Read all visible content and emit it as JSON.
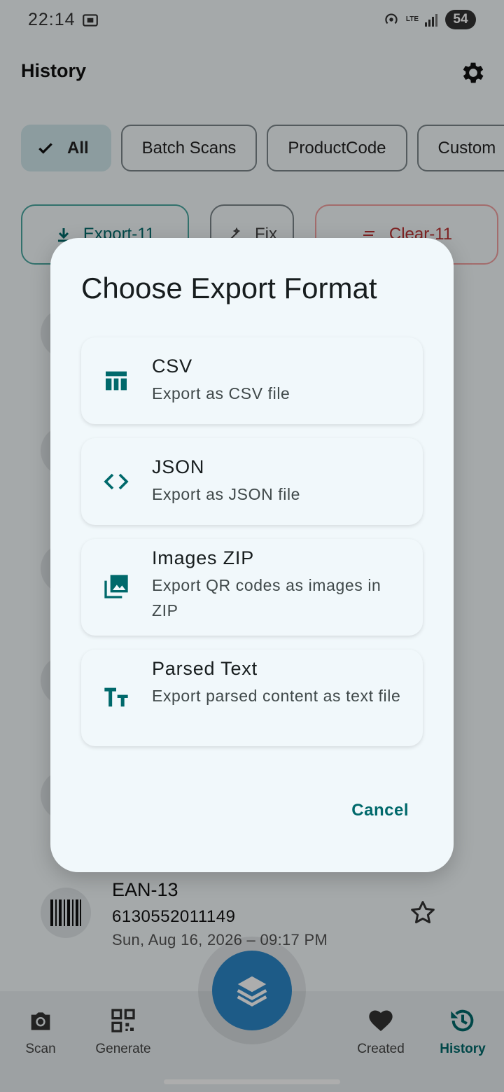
{
  "status_bar": {
    "time": "22:14",
    "network": "LTE",
    "battery": "54"
  },
  "topbar": {
    "title": "History"
  },
  "filters": [
    "All",
    "Batch Scans",
    "ProductCode",
    "Custom"
  ],
  "actions": {
    "export": "Export-11",
    "fix": "Fix",
    "clear": "Clear-11"
  },
  "dialog": {
    "title": "Choose Export Format",
    "options": [
      {
        "title": "CSV",
        "description": "Export as CSV file",
        "icon": "table-icon"
      },
      {
        "title": "JSON",
        "description": "Export as JSON file",
        "icon": "code-icon"
      },
      {
        "title": "Images ZIP",
        "description": "Export QR codes as images in ZIP",
        "icon": "images-icon"
      },
      {
        "title": "Parsed Text",
        "description": "Export parsed content as text file",
        "icon": "text-fields-icon"
      }
    ],
    "cancel": "Cancel"
  },
  "history_item": {
    "type": "EAN-13",
    "code": "6130552011149",
    "date": "Sun, Aug 16, 2026 – 09:17 PM"
  },
  "bottom_nav": {
    "scan": "Scan",
    "generate": "Generate",
    "created": "Created",
    "history": "History"
  },
  "colors": {
    "accent": "#00696b",
    "fab": "#2b86c7",
    "dialog_bg": "#f1f8fb",
    "scrim": "rgba(0,0,0,0.32)"
  }
}
